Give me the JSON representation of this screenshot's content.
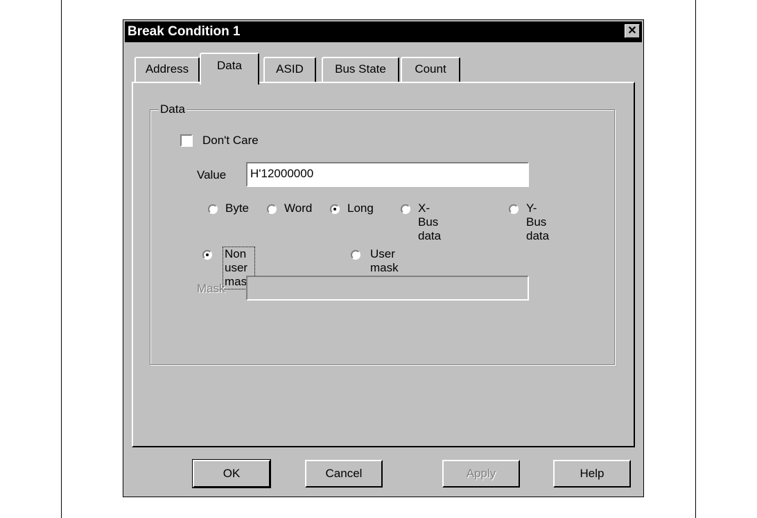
{
  "window": {
    "title": "Break Condition 1",
    "close_glyph": "✕"
  },
  "tabs": [
    {
      "label": "Address"
    },
    {
      "label": "Data"
    },
    {
      "label": "ASID"
    },
    {
      "label": "Bus State"
    },
    {
      "label": "Count"
    }
  ],
  "active_tab": "Data",
  "data_group": {
    "label": "Data",
    "dont_care": {
      "label": "Don't Care",
      "checked": false
    },
    "value": {
      "label": "Value",
      "value": "H'12000000"
    },
    "size_options": [
      {
        "label": "Byte",
        "selected": false
      },
      {
        "label": "Word",
        "selected": false
      },
      {
        "label": "Long",
        "selected": true
      },
      {
        "label": "X-Bus data",
        "selected": false
      },
      {
        "label": "Y-Bus data",
        "selected": false
      }
    ],
    "mask_options": [
      {
        "label": "Non user mask",
        "selected": true
      },
      {
        "label": "User mask",
        "selected": false
      }
    ],
    "mask": {
      "label": "Mask",
      "value": ""
    }
  },
  "buttons": {
    "ok": "OK",
    "cancel": "Cancel",
    "apply": "Apply",
    "help": "Help"
  }
}
